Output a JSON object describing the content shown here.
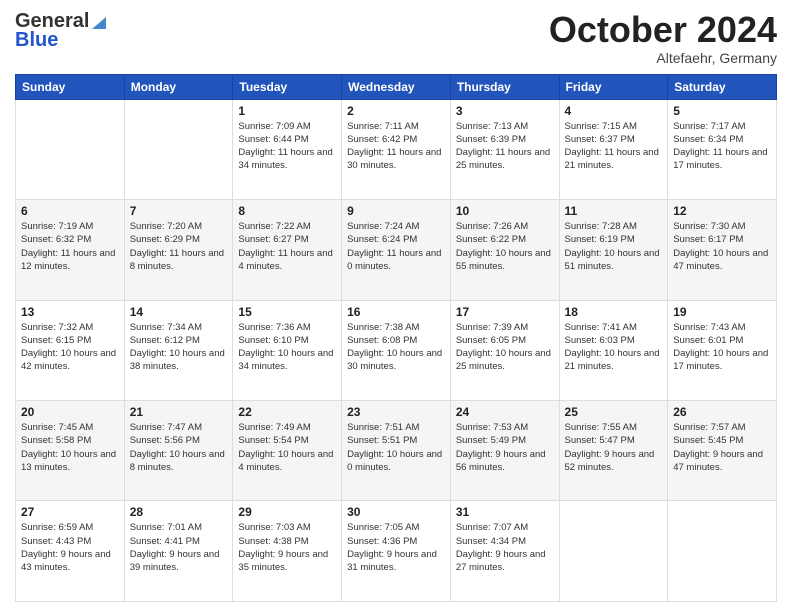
{
  "header": {
    "logo_general": "General",
    "logo_blue": "Blue",
    "month_title": "October 2024",
    "subtitle": "Altefaehr, Germany"
  },
  "days_of_week": [
    "Sunday",
    "Monday",
    "Tuesday",
    "Wednesday",
    "Thursday",
    "Friday",
    "Saturday"
  ],
  "weeks": [
    [
      {
        "day": "",
        "sunrise": "",
        "sunset": "",
        "daylight": ""
      },
      {
        "day": "",
        "sunrise": "",
        "sunset": "",
        "daylight": ""
      },
      {
        "day": "1",
        "sunrise": "Sunrise: 7:09 AM",
        "sunset": "Sunset: 6:44 PM",
        "daylight": "Daylight: 11 hours and 34 minutes."
      },
      {
        "day": "2",
        "sunrise": "Sunrise: 7:11 AM",
        "sunset": "Sunset: 6:42 PM",
        "daylight": "Daylight: 11 hours and 30 minutes."
      },
      {
        "day": "3",
        "sunrise": "Sunrise: 7:13 AM",
        "sunset": "Sunset: 6:39 PM",
        "daylight": "Daylight: 11 hours and 25 minutes."
      },
      {
        "day": "4",
        "sunrise": "Sunrise: 7:15 AM",
        "sunset": "Sunset: 6:37 PM",
        "daylight": "Daylight: 11 hours and 21 minutes."
      },
      {
        "day": "5",
        "sunrise": "Sunrise: 7:17 AM",
        "sunset": "Sunset: 6:34 PM",
        "daylight": "Daylight: 11 hours and 17 minutes."
      }
    ],
    [
      {
        "day": "6",
        "sunrise": "Sunrise: 7:19 AM",
        "sunset": "Sunset: 6:32 PM",
        "daylight": "Daylight: 11 hours and 12 minutes."
      },
      {
        "day": "7",
        "sunrise": "Sunrise: 7:20 AM",
        "sunset": "Sunset: 6:29 PM",
        "daylight": "Daylight: 11 hours and 8 minutes."
      },
      {
        "day": "8",
        "sunrise": "Sunrise: 7:22 AM",
        "sunset": "Sunset: 6:27 PM",
        "daylight": "Daylight: 11 hours and 4 minutes."
      },
      {
        "day": "9",
        "sunrise": "Sunrise: 7:24 AM",
        "sunset": "Sunset: 6:24 PM",
        "daylight": "Daylight: 11 hours and 0 minutes."
      },
      {
        "day": "10",
        "sunrise": "Sunrise: 7:26 AM",
        "sunset": "Sunset: 6:22 PM",
        "daylight": "Daylight: 10 hours and 55 minutes."
      },
      {
        "day": "11",
        "sunrise": "Sunrise: 7:28 AM",
        "sunset": "Sunset: 6:19 PM",
        "daylight": "Daylight: 10 hours and 51 minutes."
      },
      {
        "day": "12",
        "sunrise": "Sunrise: 7:30 AM",
        "sunset": "Sunset: 6:17 PM",
        "daylight": "Daylight: 10 hours and 47 minutes."
      }
    ],
    [
      {
        "day": "13",
        "sunrise": "Sunrise: 7:32 AM",
        "sunset": "Sunset: 6:15 PM",
        "daylight": "Daylight: 10 hours and 42 minutes."
      },
      {
        "day": "14",
        "sunrise": "Sunrise: 7:34 AM",
        "sunset": "Sunset: 6:12 PM",
        "daylight": "Daylight: 10 hours and 38 minutes."
      },
      {
        "day": "15",
        "sunrise": "Sunrise: 7:36 AM",
        "sunset": "Sunset: 6:10 PM",
        "daylight": "Daylight: 10 hours and 34 minutes."
      },
      {
        "day": "16",
        "sunrise": "Sunrise: 7:38 AM",
        "sunset": "Sunset: 6:08 PM",
        "daylight": "Daylight: 10 hours and 30 minutes."
      },
      {
        "day": "17",
        "sunrise": "Sunrise: 7:39 AM",
        "sunset": "Sunset: 6:05 PM",
        "daylight": "Daylight: 10 hours and 25 minutes."
      },
      {
        "day": "18",
        "sunrise": "Sunrise: 7:41 AM",
        "sunset": "Sunset: 6:03 PM",
        "daylight": "Daylight: 10 hours and 21 minutes."
      },
      {
        "day": "19",
        "sunrise": "Sunrise: 7:43 AM",
        "sunset": "Sunset: 6:01 PM",
        "daylight": "Daylight: 10 hours and 17 minutes."
      }
    ],
    [
      {
        "day": "20",
        "sunrise": "Sunrise: 7:45 AM",
        "sunset": "Sunset: 5:58 PM",
        "daylight": "Daylight: 10 hours and 13 minutes."
      },
      {
        "day": "21",
        "sunrise": "Sunrise: 7:47 AM",
        "sunset": "Sunset: 5:56 PM",
        "daylight": "Daylight: 10 hours and 8 minutes."
      },
      {
        "day": "22",
        "sunrise": "Sunrise: 7:49 AM",
        "sunset": "Sunset: 5:54 PM",
        "daylight": "Daylight: 10 hours and 4 minutes."
      },
      {
        "day": "23",
        "sunrise": "Sunrise: 7:51 AM",
        "sunset": "Sunset: 5:51 PM",
        "daylight": "Daylight: 10 hours and 0 minutes."
      },
      {
        "day": "24",
        "sunrise": "Sunrise: 7:53 AM",
        "sunset": "Sunset: 5:49 PM",
        "daylight": "Daylight: 9 hours and 56 minutes."
      },
      {
        "day": "25",
        "sunrise": "Sunrise: 7:55 AM",
        "sunset": "Sunset: 5:47 PM",
        "daylight": "Daylight: 9 hours and 52 minutes."
      },
      {
        "day": "26",
        "sunrise": "Sunrise: 7:57 AM",
        "sunset": "Sunset: 5:45 PM",
        "daylight": "Daylight: 9 hours and 47 minutes."
      }
    ],
    [
      {
        "day": "27",
        "sunrise": "Sunrise: 6:59 AM",
        "sunset": "Sunset: 4:43 PM",
        "daylight": "Daylight: 9 hours and 43 minutes."
      },
      {
        "day": "28",
        "sunrise": "Sunrise: 7:01 AM",
        "sunset": "Sunset: 4:41 PM",
        "daylight": "Daylight: 9 hours and 39 minutes."
      },
      {
        "day": "29",
        "sunrise": "Sunrise: 7:03 AM",
        "sunset": "Sunset: 4:38 PM",
        "daylight": "Daylight: 9 hours and 35 minutes."
      },
      {
        "day": "30",
        "sunrise": "Sunrise: 7:05 AM",
        "sunset": "Sunset: 4:36 PM",
        "daylight": "Daylight: 9 hours and 31 minutes."
      },
      {
        "day": "31",
        "sunrise": "Sunrise: 7:07 AM",
        "sunset": "Sunset: 4:34 PM",
        "daylight": "Daylight: 9 hours and 27 minutes."
      },
      {
        "day": "",
        "sunrise": "",
        "sunset": "",
        "daylight": ""
      },
      {
        "day": "",
        "sunrise": "",
        "sunset": "",
        "daylight": ""
      }
    ]
  ]
}
